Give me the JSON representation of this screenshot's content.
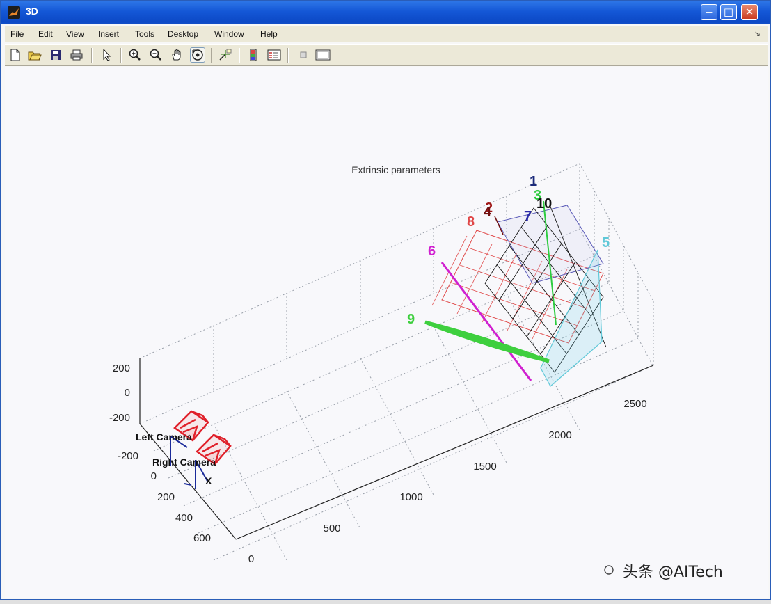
{
  "window": {
    "title": "3D",
    "controls": {
      "minimize": "‒",
      "maximize": "□",
      "close": "✕"
    }
  },
  "menubar": {
    "items": [
      "File",
      "Edit",
      "View",
      "Insert",
      "Tools",
      "Desktop",
      "Window",
      "Help"
    ],
    "overflow_icon": "dock-arrow-icon"
  },
  "toolbar": {
    "buttons": [
      {
        "name": "new-figure-icon"
      },
      {
        "name": "open-file-icon"
      },
      {
        "name": "save-icon"
      },
      {
        "name": "print-icon"
      },
      {
        "name": "select-arrow-icon"
      },
      {
        "name": "zoom-in-icon"
      },
      {
        "name": "zoom-out-icon"
      },
      {
        "name": "pan-hand-icon"
      },
      {
        "name": "rotate-3d-icon",
        "active": true
      },
      {
        "name": "data-cursor-icon"
      },
      {
        "name": "colorbar-icon"
      },
      {
        "name": "legend-icon"
      },
      {
        "name": "hide-plot-tools-icon"
      },
      {
        "name": "show-plot-tools-icon"
      }
    ]
  },
  "chart_data": {
    "type": "3d-scatter",
    "title": "Extrinsic parameters",
    "axes": {
      "z_ticks": [
        "200",
        "0",
        "-200"
      ],
      "y_ticks": [
        "-200",
        "0",
        "200",
        "400",
        "600"
      ],
      "x_ticks": [
        "0",
        "500",
        "1000",
        "1500",
        "2000",
        "2500"
      ],
      "grid": true
    },
    "cameras": [
      {
        "label": "Left Camera",
        "color": "#e0202a"
      },
      {
        "label": "Right Camera",
        "color": "#e0202a"
      }
    ],
    "axis_marker": "X",
    "planes": [
      {
        "label": "1",
        "color": "#1b2a7a"
      },
      {
        "label": "2",
        "color": "#a01818"
      },
      {
        "label": "3",
        "color": "#2ecc40"
      },
      {
        "label": "4",
        "color": "#701010"
      },
      {
        "label": "5",
        "color": "#5fc8d8"
      },
      {
        "label": "6",
        "color": "#d020d0"
      },
      {
        "label": "7",
        "color": "#2a2aa8"
      },
      {
        "label": "8",
        "color": "#e04848"
      },
      {
        "label": "9",
        "color": "#3ecf3e"
      },
      {
        "label": "10",
        "color": "#111111"
      }
    ]
  },
  "watermark": "头条 @AITech"
}
